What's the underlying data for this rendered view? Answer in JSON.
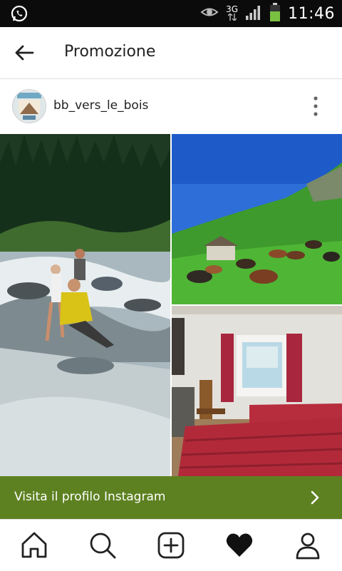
{
  "status_bar": {
    "left_icon": "whatsapp-icon",
    "right_icons": [
      "eye-icon",
      "signal-icon",
      "battery-icon"
    ],
    "network": "3G",
    "time": "11:46"
  },
  "app_bar": {
    "back_icon": "arrow-left-icon",
    "title": "Promozione"
  },
  "post": {
    "username": "bb_vers_le_bois",
    "avatar_icon": "profile-avatar",
    "more_icon": "more-vertical-icon"
  },
  "images": [
    {
      "name": "photo-river-children",
      "icon": "photo"
    },
    {
      "name": "photo-alpine-cows",
      "icon": "photo"
    },
    {
      "name": "photo-bedroom",
      "icon": "photo"
    }
  ],
  "cta": {
    "label": "Visita il profilo Instagram",
    "icon": "chevron-right-icon",
    "color": "#5d8121"
  },
  "tab_bar": {
    "items": [
      {
        "icon": "home-icon"
      },
      {
        "icon": "search-icon"
      },
      {
        "icon": "add-post-icon"
      },
      {
        "icon": "heart-icon"
      },
      {
        "icon": "profile-icon"
      }
    ]
  }
}
